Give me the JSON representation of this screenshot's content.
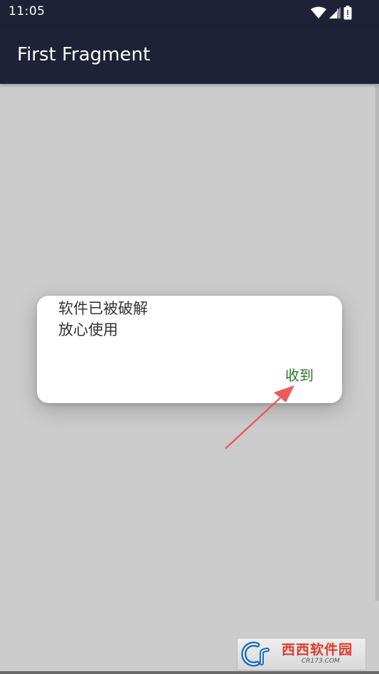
{
  "status_bar": {
    "time": "11:05",
    "icons": [
      "wifi-icon",
      "signal-icon",
      "battery-icon"
    ]
  },
  "app_bar": {
    "title": "First Fragment"
  },
  "dialog": {
    "message_lines": [
      "软件已被破解",
      "放心使用"
    ],
    "positive_button": "收到"
  },
  "watermark": {
    "text": "西西软件园",
    "subtext": "CR173.COM"
  },
  "colors": {
    "app_bar": "#1f2237",
    "background": "#cccccc",
    "dialog": "#ffffff",
    "button_text": "#2a7a2a",
    "arrow": "#ee5a5a"
  }
}
